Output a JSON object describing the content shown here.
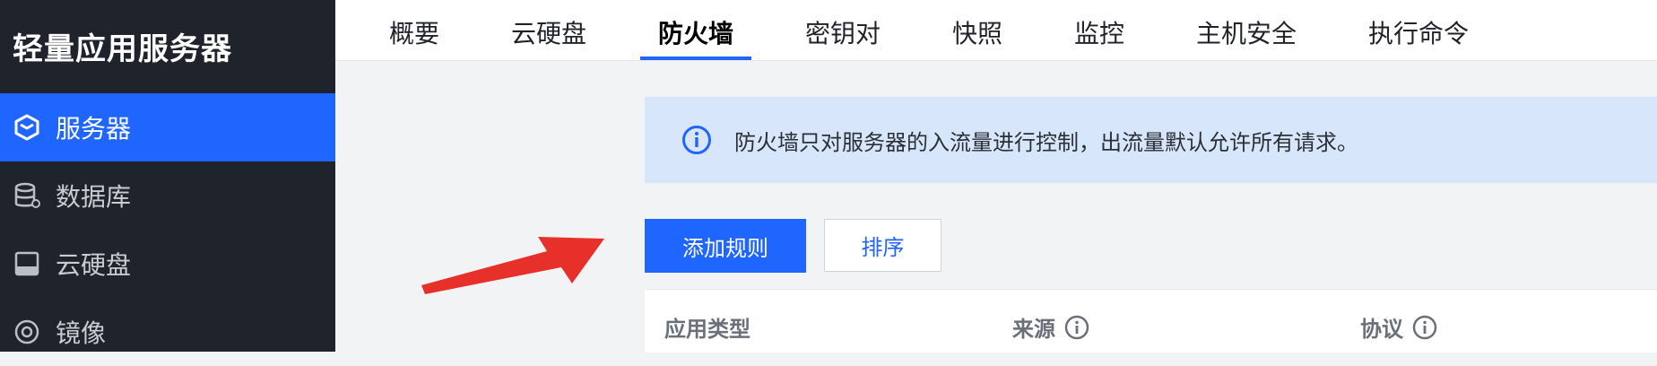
{
  "sidebar": {
    "title": "轻量应用服务器",
    "items": [
      {
        "label": "服务器",
        "icon": "cube-server-icon",
        "active": true
      },
      {
        "label": "数据库",
        "icon": "database-icon",
        "active": false
      },
      {
        "label": "云硬盘",
        "icon": "disk-icon",
        "active": false
      },
      {
        "label": "镜像",
        "icon": "image-target-icon",
        "active": false
      }
    ]
  },
  "tabs": [
    {
      "label": "概要"
    },
    {
      "label": "云硬盘"
    },
    {
      "label": "防火墙",
      "active": true
    },
    {
      "label": "密钥对"
    },
    {
      "label": "快照"
    },
    {
      "label": "监控"
    },
    {
      "label": "主机安全"
    },
    {
      "label": "执行命令"
    }
  ],
  "banner": {
    "icon": "info-icon",
    "text": "防火墙只对服务器的入流量进行控制，出流量默认允许所有请求。"
  },
  "actions": {
    "add_rule": "添加规则",
    "sort": "排序"
  },
  "table": {
    "columns": [
      {
        "label": "应用类型",
        "help": false
      },
      {
        "label": "来源",
        "help": true
      },
      {
        "label": "协议",
        "help": true
      }
    ]
  },
  "colors": {
    "accent": "#1f65ff",
    "sidebar_bg": "#1f232c",
    "banner_bg": "#d8e6fb",
    "annotation_arrow": "#e8302a"
  }
}
